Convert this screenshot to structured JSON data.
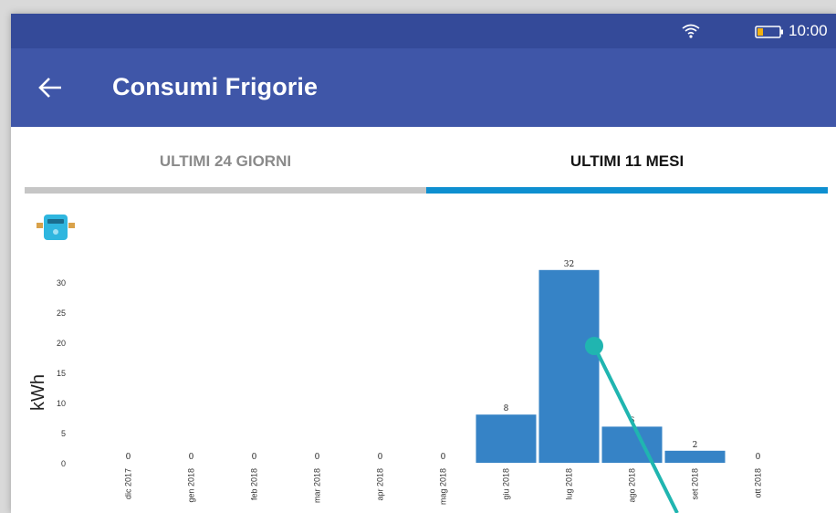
{
  "status_bar": {
    "time": "10:00"
  },
  "app_bar": {
    "title": "Consumi Frigorie",
    "back_icon": "arrow-left-icon"
  },
  "tabs": [
    {
      "label": "ULTIMI 24 GIORNI",
      "selected": false
    },
    {
      "label": "ULTIMI 11 MESI",
      "selected": true
    }
  ],
  "colors": {
    "status_bar": "#344a99",
    "app_bar": "#3f56a8",
    "tab_indicator": "#0e8fd0",
    "bar": "#3683c6",
    "touch_marker": "#20b5b0"
  },
  "chart_data": {
    "type": "bar",
    "ylabel": "kWh",
    "ylim": [
      0,
      32
    ],
    "y_ticks": [
      "0",
      "5",
      "10",
      "15",
      "20",
      "25",
      "30"
    ],
    "categories": [
      "dic 2017",
      "gen 2018",
      "feb 2018",
      "mar 2018",
      "apr 2018",
      "mag 2018",
      "giu 2018",
      "lug 2018",
      "ago 2018",
      "set 2018",
      "ott 2018"
    ],
    "values": [
      0,
      0,
      0,
      0,
      0,
      0,
      8,
      32,
      6,
      2,
      0
    ],
    "value_labels": [
      "0",
      "0",
      "0",
      "0",
      "0",
      "0",
      "8",
      "32",
      "6",
      "2",
      "0"
    ],
    "grid": false,
    "legend": "none"
  }
}
